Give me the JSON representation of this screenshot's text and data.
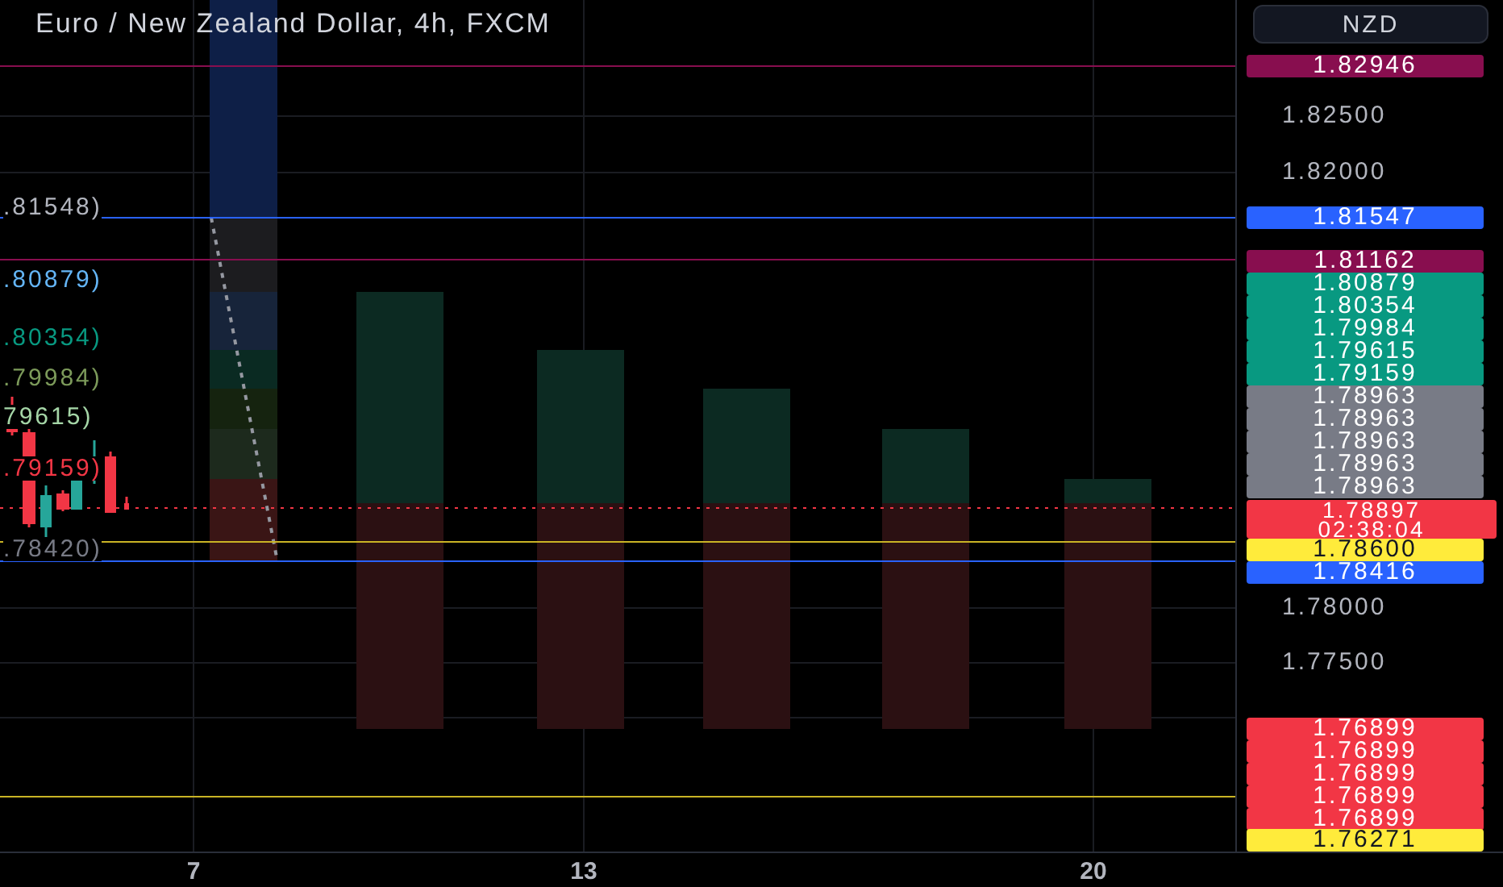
{
  "chart_title": "Euro / New Zealand Dollar, 4h, FXCM",
  "currency_button": "NZD",
  "fib_labels": [
    {
      "text": ".81548)",
      "color": "#b2b5be"
    },
    {
      "text": ".80879)",
      "color": "#64b5f6"
    },
    {
      "text": ".80354)",
      "color": "#089981"
    },
    {
      "text": ".79984)",
      "color": "#7c9a5a"
    },
    {
      "text": "79615)",
      "color": "#a5d6a7"
    },
    {
      "text": ".79159)",
      "color": "#f23645"
    },
    {
      "text": ".78420)",
      "color": "#787b86"
    }
  ],
  "price_axis": [
    {
      "kind": "tag",
      "text": "1.82946",
      "color": "#880e4f"
    },
    {
      "kind": "tick",
      "text": "1.82500"
    },
    {
      "kind": "tick",
      "text": "1.82000"
    },
    {
      "kind": "tag",
      "text": "1.81547",
      "color": "#2962ff"
    },
    {
      "kind": "tag",
      "text": "1.81162",
      "color": "#880e4f"
    },
    {
      "kind": "tag",
      "text": "1.80879",
      "color": "#089981"
    },
    {
      "kind": "tag",
      "text": "1.80354",
      "color": "#089981"
    },
    {
      "kind": "tag",
      "text": "1.79984",
      "color": "#089981"
    },
    {
      "kind": "tag",
      "text": "1.79615",
      "color": "#089981"
    },
    {
      "kind": "tag",
      "text": "1.79159",
      "color": "#089981"
    },
    {
      "kind": "tag",
      "text": "1.78963",
      "color": "#787b86"
    },
    {
      "kind": "tag",
      "text": "1.78963",
      "color": "#787b86"
    },
    {
      "kind": "tag",
      "text": "1.78963",
      "color": "#787b86"
    },
    {
      "kind": "tag",
      "text": "1.78963",
      "color": "#787b86"
    },
    {
      "kind": "tag",
      "text": "1.78963",
      "color": "#787b86"
    },
    {
      "kind": "current",
      "text": "1.78897",
      "countdown": "02:38:04",
      "color": "#f23645"
    },
    {
      "kind": "tag",
      "text": "1.78600",
      "color": "#ffeb3b"
    },
    {
      "kind": "tag",
      "text": "1.78416",
      "color": "#2962ff"
    },
    {
      "kind": "tick",
      "text": "1.78000"
    },
    {
      "kind": "tick",
      "text": "1.77500"
    },
    {
      "kind": "tag",
      "text": "1.76899",
      "color": "#f23645"
    },
    {
      "kind": "tag",
      "text": "1.76899",
      "color": "#f23645"
    },
    {
      "kind": "tag",
      "text": "1.76899",
      "color": "#f23645"
    },
    {
      "kind": "tag",
      "text": "1.76899",
      "color": "#f23645"
    },
    {
      "kind": "tag",
      "text": "1.76899",
      "color": "#f23645"
    },
    {
      "kind": "tag",
      "text": "1.76271",
      "color": "#ffeb3b"
    }
  ],
  "time_axis": [
    "7",
    "13",
    "20"
  ]
}
